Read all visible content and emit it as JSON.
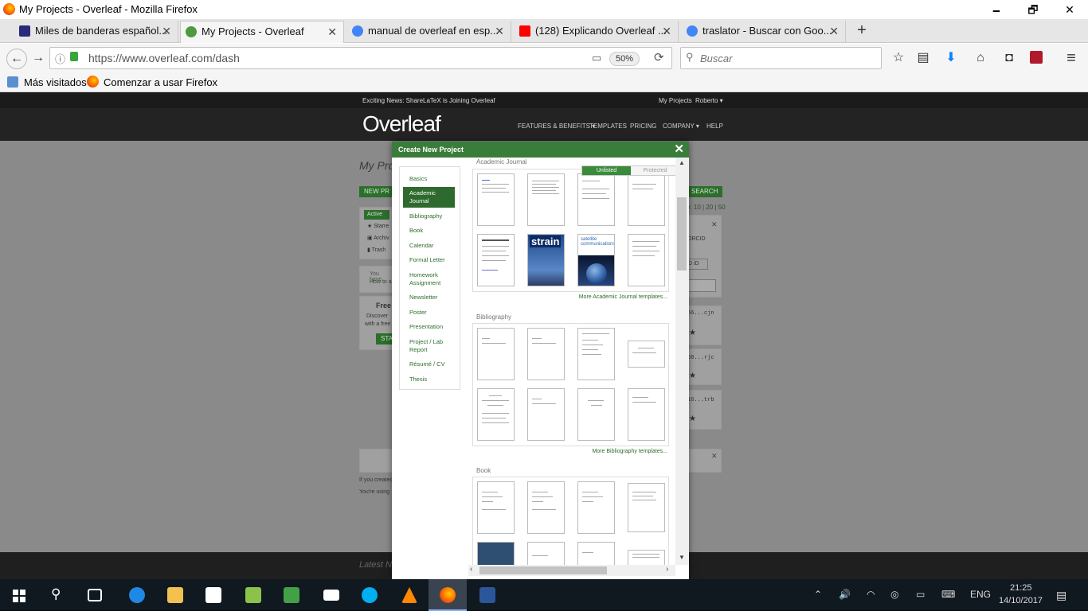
{
  "window": {
    "title": "My Projects - Overleaf - Mozilla Firefox",
    "minimize": "🗕",
    "restore": "🗗",
    "close": "✕"
  },
  "tabs": [
    {
      "label": "Miles de banderas español...",
      "icon_color": "#2a2a7a"
    },
    {
      "label": "My Projects - Overleaf",
      "icon_color": "#4f9a3f"
    },
    {
      "label": "manual de overleaf en esp...",
      "icon_color": "#4285f4"
    },
    {
      "label": "(128) Explicando Overleaf ...",
      "icon_color": "#ff0000"
    },
    {
      "label": "traslator - Buscar con Goo...",
      "icon_color": "#4285f4"
    }
  ],
  "tab_close": "✕",
  "new_tab": "+",
  "nav": {
    "back": "←",
    "forward": "→",
    "info": "ⓘ",
    "lock": "🔒",
    "url": "https://www.overleaf.com/dash",
    "zoom": "50%",
    "reload": "⟳",
    "search_placeholder": "Buscar",
    "star": "☆",
    "library": "▤",
    "download": "⬇",
    "home": "⌂",
    "pocket": "◘",
    "menu": "≡"
  },
  "bookmarks": {
    "most_visited": "Más visitados",
    "getting_started": "Comenzar a usar Firefox"
  },
  "site": {
    "news": "Exciting News: ShareLaTeX is Joining Overleaf",
    "my_projects": "My Projects",
    "user": "Roberto ▾",
    "logo": "Overleaf",
    "nav": [
      "FEATURES & BENEFITS ▾",
      "TEMPLATES",
      "PRICING",
      "COMPANY ▾",
      "HELP"
    ],
    "page_title": "My Proj",
    "new_btn": "NEW PR",
    "search_btn": "SEARCH",
    "per_page": "e: 10 | 20 | 50",
    "filters": [
      "Active",
      "★ Starre",
      "▣ Archiv",
      "▮ Trash"
    ],
    "notice": [
      "You have",
      "How to a"
    ],
    "free_title": "Free",
    "free_text": [
      "Discover",
      "with a free"
    ],
    "start_btn": "STA",
    "orcid": "ORCID",
    "orcid_id": "D iD",
    "ids": [
      "66...cjn",
      "60...rjc",
      "16...trb"
    ],
    "footer_text": [
      "If you created",
      "You're using"
    ],
    "latest": "Latest N"
  },
  "modal": {
    "title": "Create New Project",
    "close": "✕",
    "categories": [
      "Basics",
      "Academic Journal",
      "Bibliography",
      "Book",
      "Calendar",
      "Formal Letter",
      "Homework Assignment",
      "Newsletter",
      "Poster",
      "Presentation",
      "Project / Lab Report",
      "Résumé / CV",
      "Thesis"
    ],
    "active_category": "Academic Journal",
    "toggle_on": "Unlisted",
    "toggle_off": "Protected",
    "sections": [
      {
        "title": "Academic Journal",
        "more": "More Academic Journal templates..."
      },
      {
        "title": "Bibliography",
        "more": "More Bibliography templates..."
      },
      {
        "title": "Book",
        "more": ""
      }
    ],
    "thumb_strain": "strain",
    "thumb_satellite": "satellite communications"
  },
  "taskbar": {
    "lang": "ENG",
    "time": "21:25",
    "date": "14/10/2017"
  }
}
